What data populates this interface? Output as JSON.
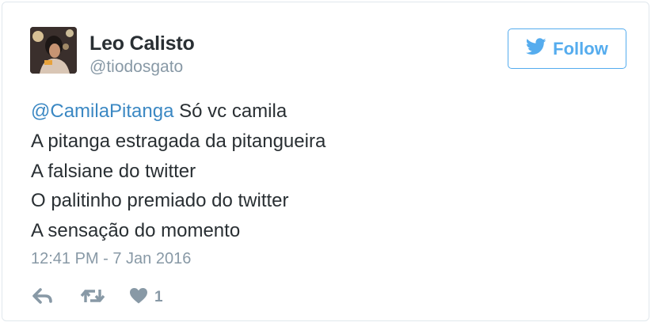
{
  "user": {
    "display_name": "Leo Calisto",
    "screen_name": "@tiodosgato"
  },
  "follow_button": {
    "label": "Follow",
    "icon": "twitter-bird-icon"
  },
  "tweet": {
    "mention": "@CamilaPitanga",
    "line1_rest": " Só vc camila",
    "lines": [
      "A pitanga estragada da pitangueira",
      "A falsiane do twitter",
      "O palitinho premiado do twitter",
      "A sensação do momento"
    ],
    "timestamp": "12:41 PM - 7 Jan 2016"
  },
  "actions": {
    "reply_icon": "reply-arrow-icon",
    "retweet_icon": "retweet-icon",
    "like_icon": "heart-icon",
    "like_count": "1"
  },
  "colors": {
    "accent": "#55acee",
    "mention": "#3b88c3",
    "text": "#292f33",
    "muted": "#8899a6"
  }
}
